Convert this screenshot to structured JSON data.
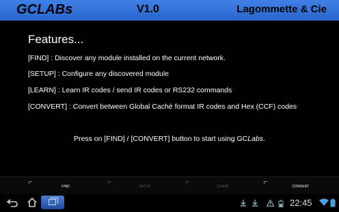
{
  "header": {
    "app_name": "GCLABs",
    "version": "V1.0",
    "company": "Lagommette & Cie"
  },
  "main": {
    "heading": "Features...",
    "features": [
      "[FIND] : Discover any module installed on the current network.",
      "[SETUP] : Configure any discovered module",
      "[LEARN] : Learn IR codes / send IR codes or RS232 commands",
      "[CONVERT] : Convert between Global Caché format IR codes and Hex (CCF) codes"
    ],
    "hint_prefix": "Press on [FIND] / [CONVERT] button to start using GC",
    "hint_suffix": "Labs",
    "hint_end": "."
  },
  "buttons": [
    {
      "label": "FIND",
      "state": "active"
    },
    {
      "label": "SETUP",
      "state": "disabled"
    },
    {
      "label": "LEARN",
      "state": "disabled"
    },
    {
      "label": "CONVERT",
      "state": "active"
    }
  ],
  "system_bar": {
    "clock": "22:45",
    "icons": [
      "back-icon",
      "home-icon",
      "recent-apps-icon",
      "download-icon",
      "download-icon",
      "alert-icon",
      "battery-status-icon",
      "wifi-icon",
      "battery-icon"
    ]
  },
  "colors": {
    "title_bar": "#2a66cc",
    "background": "#000000",
    "text": "#ffffff"
  }
}
